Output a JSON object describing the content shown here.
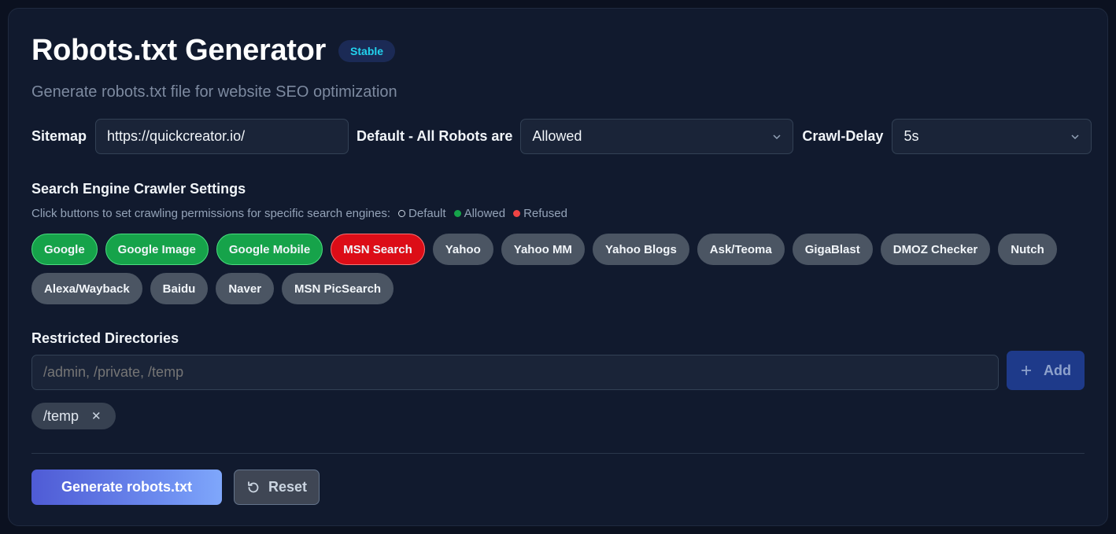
{
  "header": {
    "title": "Robots.txt Generator",
    "badge": "Stable",
    "subtitle": "Generate robots.txt file for website SEO optimization"
  },
  "config": {
    "sitemap_label": "Sitemap",
    "sitemap_value": "https://quickcreator.io/",
    "default_label": "Default - All Robots are",
    "default_value": "Allowed",
    "crawl_delay_label": "Crawl-Delay",
    "crawl_delay_value": "5s"
  },
  "crawlers": {
    "title": "Search Engine Crawler Settings",
    "hint": "Click buttons to set crawling permissions for specific search engines:",
    "legend": {
      "default": "Default",
      "allowed": "Allowed",
      "refused": "Refused"
    },
    "row1": [
      {
        "label": "Google",
        "state": "allowed"
      },
      {
        "label": "Google Image",
        "state": "allowed"
      },
      {
        "label": "Google Mobile",
        "state": "allowed"
      },
      {
        "label": "MSN Search",
        "state": "refused"
      },
      {
        "label": "Yahoo",
        "state": "default"
      },
      {
        "label": "Yahoo MM",
        "state": "default"
      },
      {
        "label": "Yahoo Blogs",
        "state": "default"
      },
      {
        "label": "Ask/Teoma",
        "state": "default"
      },
      {
        "label": "GigaBlast",
        "state": "default"
      },
      {
        "label": "DMOZ Checker",
        "state": "default"
      },
      {
        "label": "Nutch",
        "state": "default"
      }
    ],
    "row2": [
      {
        "label": "Alexa/Wayback",
        "state": "default"
      },
      {
        "label": "Baidu",
        "state": "default"
      },
      {
        "label": "Naver",
        "state": "default"
      },
      {
        "label": "MSN PicSearch",
        "state": "default"
      }
    ]
  },
  "directories": {
    "title": "Restricted Directories",
    "placeholder": "/admin, /private, /temp",
    "add_label": "Add",
    "tags": [
      "/temp"
    ],
    "remove_glyph": "✕"
  },
  "actions": {
    "generate_label": "Generate robots.txt",
    "reset_label": "Reset"
  },
  "colors": {
    "allowed": "#16a34a",
    "refused": "#dc0d17",
    "default": "#4b5563",
    "badge_text": "#22d3ee"
  }
}
